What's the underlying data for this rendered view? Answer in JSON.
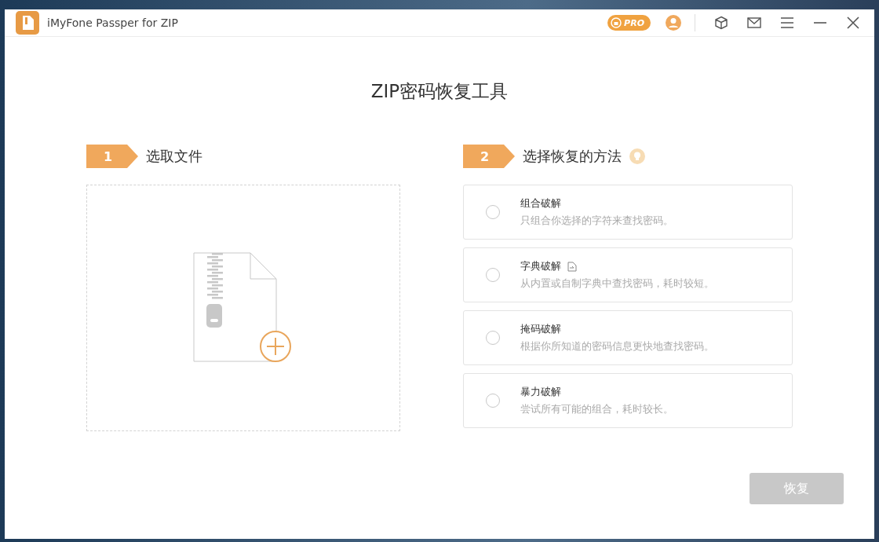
{
  "window": {
    "title": "iMyFone Passper for ZIP",
    "pro_badge": "PRO"
  },
  "heading": "ZIP密码恢复工具",
  "step_file": {
    "number": "1",
    "label": "选取文件"
  },
  "step_method": {
    "number": "2",
    "label": "选择恢复的方法"
  },
  "methods": [
    {
      "name": "组合破解",
      "description": "只组合你选择的字符来查找密码。",
      "selected": false,
      "has_file_icon": false
    },
    {
      "name": "字典破解",
      "description": "从内置或自制字典中查找密码，耗时较短。",
      "selected": false,
      "has_file_icon": true
    },
    {
      "name": "掩码破解",
      "description": "根据你所知道的密码信息更快地查找密码。",
      "selected": false,
      "has_file_icon": false
    },
    {
      "name": "暴力破解",
      "description": "尝试所有可能的组合，耗时较长。",
      "selected": false,
      "has_file_icon": false
    }
  ],
  "recover_button": {
    "label": "恢复",
    "disabled": true
  }
}
